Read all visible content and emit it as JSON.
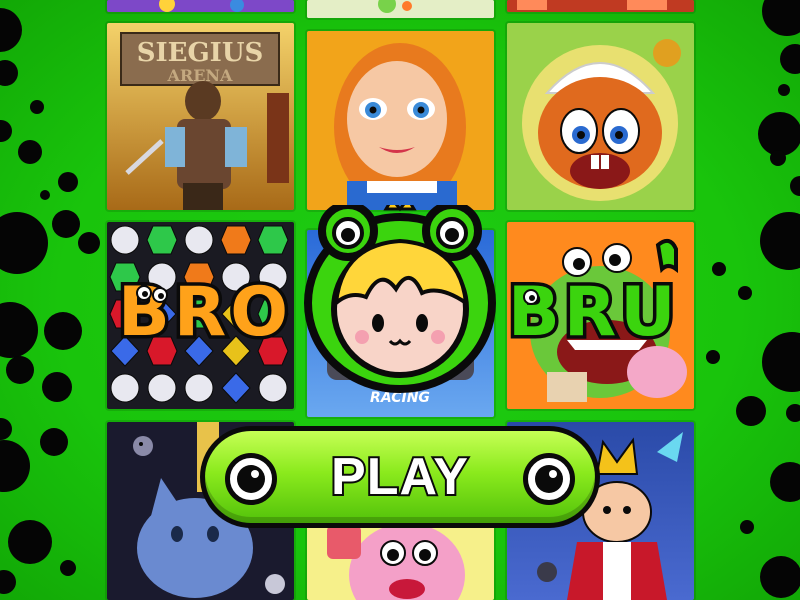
{
  "logo": {
    "word_left": "BRO",
    "word_right": "BRU",
    "mascot": "frog-hat-kid-icon"
  },
  "play_button": {
    "label": "PLAY"
  },
  "tiles": [
    {
      "name": "sieglus-arena-thumbnail",
      "caption": "SIEGIUS",
      "caption2": "ARENA"
    },
    {
      "name": "redhead-girl-thumbnail",
      "caption": ""
    },
    {
      "name": "squirrel-maid-thumbnail",
      "caption": ""
    },
    {
      "name": "gem-puzzle-thumbnail",
      "caption": ""
    },
    {
      "name": "racing-thumbnail",
      "caption": "RACING"
    },
    {
      "name": "monster-cake-thumbnail",
      "caption": ""
    },
    {
      "name": "blue-cat-thumbnail",
      "caption": ""
    },
    {
      "name": "pink-monster-thumbnail",
      "caption": ""
    },
    {
      "name": "king-thumbnail",
      "caption": ""
    }
  ],
  "colors": {
    "background": "#19c40c",
    "dots": "#050505",
    "button_top": "#c6ff55",
    "button_bottom": "#52c20a",
    "logo_orange": "#ffa21a",
    "logo_green": "#3bd40e"
  }
}
